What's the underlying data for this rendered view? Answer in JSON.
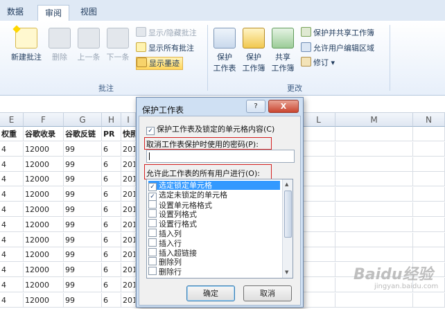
{
  "ribbon": {
    "tabs": [
      "数据",
      "审阅",
      "视图"
    ],
    "group_comments": {
      "label": "批注",
      "new_comment": "新建批注",
      "delete": "删除",
      "prev": "上一条",
      "next": "下一条",
      "show_hide": "显示/隐藏批注",
      "show_all": "显示所有批注",
      "show_ink": "显示墨迹"
    },
    "group_changes": {
      "label": "更改",
      "protect_sheet": [
        "保护",
        "工作表"
      ],
      "protect_workbook": [
        "保护",
        "工作簿"
      ],
      "share_workbook": [
        "共享",
        "工作簿"
      ],
      "protect_share": "保护并共享工作簿",
      "allow_edit": "允许用户编辑区域",
      "track": "修订"
    }
  },
  "sheet": {
    "columns": [
      "E",
      "F",
      "G",
      "H",
      "I",
      "L",
      "M",
      "N"
    ],
    "headers": [
      "权重",
      "谷歌收录",
      "谷歌反链",
      "PR",
      "快照"
    ],
    "row_values": [
      "4",
      "12000",
      "99",
      "6",
      "201"
    ],
    "row_count": 12
  },
  "dialog": {
    "title": "保护工作表",
    "help": "?",
    "close": "X",
    "protect_option": "保护工作表及锁定的单元格内容(C)",
    "password_label": "取消工作表保护时使用的密码(P):",
    "allow_label": "允许此工作表的所有用户进行(O):",
    "permissions": [
      {
        "label": "选定锁定单元格",
        "checked": true,
        "selected": true
      },
      {
        "label": "选定未锁定的单元格",
        "checked": true,
        "selected": false
      },
      {
        "label": "设置单元格格式",
        "checked": false,
        "selected": false
      },
      {
        "label": "设置列格式",
        "checked": false,
        "selected": false
      },
      {
        "label": "设置行格式",
        "checked": false,
        "selected": false
      },
      {
        "label": "插入列",
        "checked": false,
        "selected": false
      },
      {
        "label": "插入行",
        "checked": false,
        "selected": false
      },
      {
        "label": "插入超链接",
        "checked": false,
        "selected": false
      },
      {
        "label": "删除列",
        "checked": false,
        "selected": false
      },
      {
        "label": "删除行",
        "checked": false,
        "selected": false
      }
    ],
    "ok": "确定",
    "cancel": "取消"
  },
  "watermark": {
    "main": "Baidu经验",
    "sub": "jingyan.baidu.com"
  },
  "colors": {
    "accent_red": "#d42020",
    "selection": "#3399ff",
    "ink_button": "#ffd55a"
  }
}
